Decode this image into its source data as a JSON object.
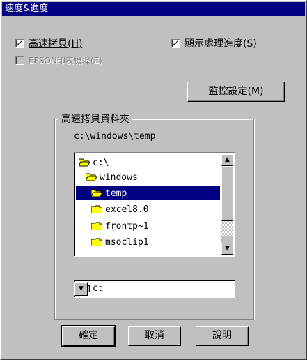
{
  "window": {
    "title": "速度&進度"
  },
  "options": {
    "high_speed_copy": {
      "label": "高速拷貝(H)",
      "checked": true
    },
    "show_progress": {
      "label": "顯示處理進度(S)",
      "checked": true
    },
    "epson_printer_port": {
      "label": "EPSON印表機埠(E)",
      "checked": false,
      "enabled": false
    }
  },
  "buttons": {
    "monitor_settings": "監控設定(M)",
    "ok": "確定",
    "cancel": "取消",
    "help": "說明"
  },
  "folder_group": {
    "title": "高速拷貝資料夾",
    "current_path": "c:\\windows\\temp",
    "folders": [
      {
        "name": "c:\\",
        "selected": false,
        "open": true
      },
      {
        "name": "windows",
        "selected": false,
        "open": true
      },
      {
        "name": "temp",
        "selected": true,
        "open": true
      },
      {
        "name": "excel8.0",
        "selected": false,
        "open": false
      },
      {
        "name": "frontp~1",
        "selected": false,
        "open": false
      },
      {
        "name": "msoclip1",
        "selected": false,
        "open": false
      }
    ],
    "drive": "c:"
  },
  "colors": {
    "titlebar": "#000080",
    "face": "#c0c0c0",
    "selection": "#000080",
    "folder": "#ffff00"
  }
}
